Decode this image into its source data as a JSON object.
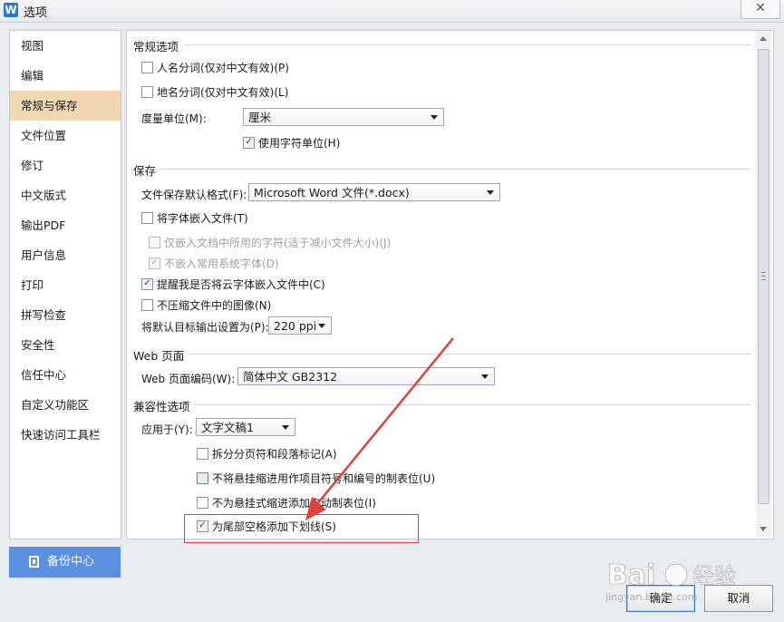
{
  "window": {
    "title": "选项",
    "app_icon_letter": "W",
    "close_glyph": "✕"
  },
  "nav": {
    "items": [
      "视图",
      "编辑",
      "常规与保存",
      "文件位置",
      "修订",
      "中文版式",
      "输出PDF",
      "用户信息",
      "打印",
      "拼写检查",
      "安全性",
      "信任中心",
      "自定义功能区",
      "快速访问工具栏"
    ],
    "active_index": 2
  },
  "backup_button": {
    "label": "备份中心"
  },
  "general": {
    "title": "常规选项",
    "person_names": {
      "label": "人名分词(仅对中文有效)(P)",
      "checked": false
    },
    "place_names": {
      "label": "地名分词(仅对中文有效)(L)",
      "checked": false
    },
    "unit_label": "度量单位(M):",
    "unit_value": "厘米",
    "char_units": {
      "label": "使用字符单位(H)",
      "checked": true
    }
  },
  "save": {
    "title": "保存",
    "default_format_label": "文件保存默认格式(F):",
    "default_format_value": "Microsoft Word 文件(*.docx)",
    "embed_fonts": {
      "label": "将字体嵌入文件(T)",
      "checked": false
    },
    "embed_used_only": {
      "label": "仅嵌入文档中所用的字符(适于减小文件大小)(J)",
      "checked": false,
      "disabled": true
    },
    "no_system_fonts": {
      "label": "不嵌入常用系统字体(D)",
      "checked": true,
      "disabled": true
    },
    "remind_cloud_fonts": {
      "label": "提醒我是否将云字体嵌入文件中(C)",
      "checked": true
    },
    "no_compress": {
      "label": "不压缩文件中的图像(N)",
      "checked": false
    },
    "target_output_label": "将默认目标输出设置为(P):",
    "target_output_value": "220 ppi"
  },
  "web": {
    "title": "Web 页面",
    "encoding_label": "Web 页面编码(W):",
    "encoding_value": "简体中文 GB2312"
  },
  "compat": {
    "title": "兼容性选项",
    "apply_label": "应用于(Y):",
    "apply_value": "文字文稿1",
    "split_page_break": {
      "label": "拆分分页符和段落标记(A)",
      "checked": false
    },
    "no_hanging_indent_tab": {
      "label": "不将悬挂缩进用作项目符号和编号的制表位(U)",
      "checked": false
    },
    "no_auto_tab_hanging": {
      "label": "不为悬挂式缩进添加自动制表位(I)",
      "checked": false
    },
    "underline_trailing_spaces": {
      "label": "为尾部空格添加下划线(S)",
      "checked": true
    }
  },
  "buttons": {
    "ok": "确定",
    "cancel": "取消"
  },
  "watermark": {
    "brand": "Bai",
    "suffix": "经验",
    "url": "jingyan.baidu.com"
  },
  "colors": {
    "nav_active_bg": "#f1d8b2",
    "backup_bg": "#5b8fe0",
    "annotation_red": "#e0403b"
  }
}
